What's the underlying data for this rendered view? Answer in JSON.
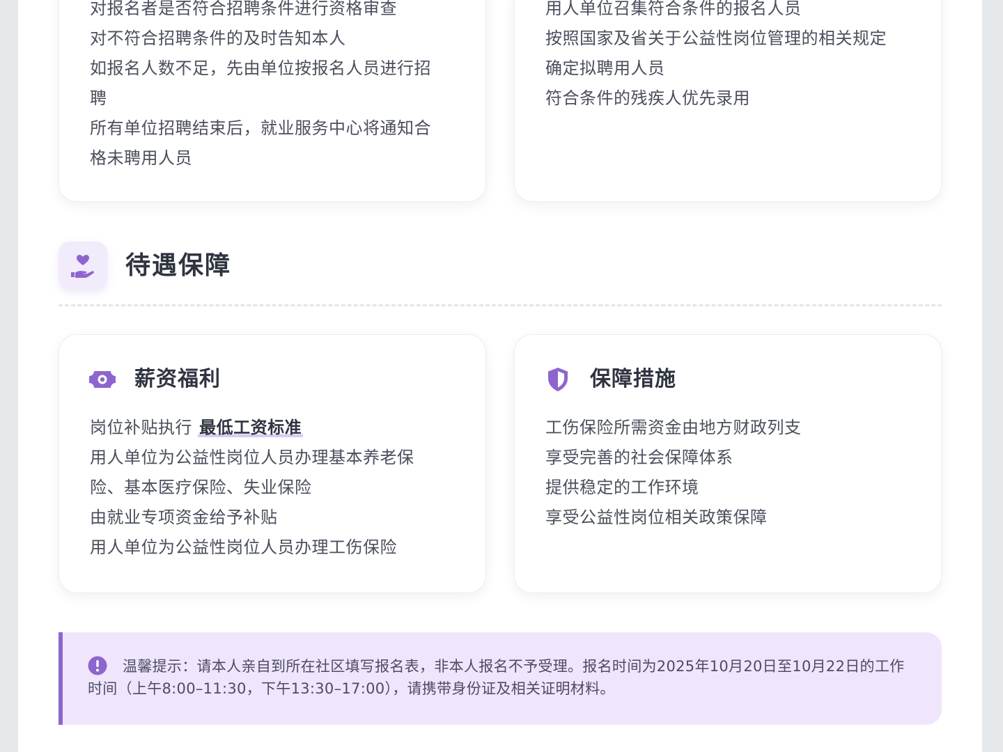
{
  "recruit_review": {
    "lines": [
      "对报名者是否符合招聘条件进行资格审查",
      "对不符合招聘条件的及时告知本人",
      "如报名人数不足，先由单位按报名人员进行招",
      "聘",
      "所有单位招聘结束后，就业服务中心将通知合",
      "格未聘用人员"
    ]
  },
  "recruit_hiring": {
    "lines": [
      "用人单位召集符合条件的报名人员",
      "按照国家及省关于公益性岗位管理的相关规定",
      "确定拟聘用人员",
      "符合条件的残疾人优先录用"
    ]
  },
  "benefits_section": {
    "icon": "hand-heart-icon",
    "title": "待遇保障"
  },
  "salary_card": {
    "icon": "money-bill-icon",
    "title": "薪资福利",
    "line1_prefix": "岗位补贴执行",
    "line1_highlight": "最低工资标准",
    "lines": [
      "用人单位为公益性岗位人员办理基本养老保",
      "险、基本医疗保险、失业保险",
      "由就业专项资金给予补贴",
      "用人单位为公益性岗位人员办理工伤保险"
    ]
  },
  "protection_card": {
    "icon": "shield-icon",
    "title": "保障措施",
    "lines": [
      "工伤保险所需资金由地方财政列支",
      "享受完善的社会保障体系",
      "提供稳定的工作环境",
      "享受公益性岗位相关政策保障"
    ]
  },
  "notice": {
    "icon": "exclamation-circle-icon",
    "text": "温馨提示：请本人亲自到所在社区填写报名表，非本人报名不予受理。报名时间为2025年10月20日至10月22日的工作时间（上午8:00–11:30，下午13:30–17:00），请携带身份证及相关证明材料。"
  },
  "colors": {
    "accent": "#8e65cf",
    "notice_bg": "#efe6fc",
    "title": "#2f3440",
    "body_text": "#4a4f5c"
  }
}
